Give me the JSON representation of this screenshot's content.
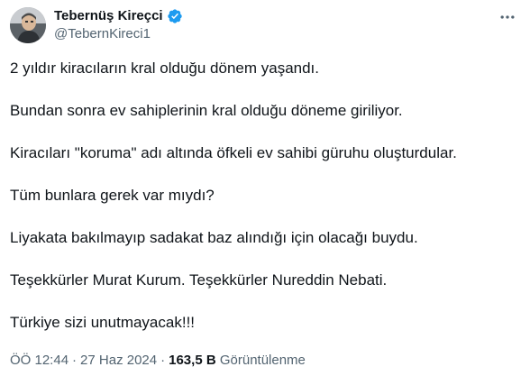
{
  "author": {
    "display_name": "Tebernüş Kireçci",
    "handle": "@TebernKireci1",
    "verified": true
  },
  "tweet": {
    "paragraphs": [
      "2 yıldır kiracıların kral olduğu dönem yaşandı.",
      "Bundan sonra ev sahiplerinin kral olduğu döneme giriliyor.",
      "Kiracıları \"koruma\" adı altında öfkeli ev sahibi güruhu oluşturdular.",
      "Tüm bunlara gerek var mıydı?",
      "Liyakata bakılmayıp sadakat baz alındığı için olacağı buydu.",
      "Teşekkürler Murat Kurum. Teşekkürler Nureddin Nebati.",
      "Türkiye sizi unutmayacak!!!"
    ]
  },
  "meta": {
    "time": "ÖÖ 12:44",
    "separator1": "·",
    "date": "27 Haz 2024",
    "separator2": "·",
    "views_count": "163,5 B",
    "views_label": "Görüntülenme"
  },
  "colors": {
    "text": "#0f1419",
    "secondary": "#536471",
    "verified_blue": "#1d9bf0"
  },
  "icons": {
    "verified": "verified-badge-icon",
    "more": "more-options-icon"
  }
}
